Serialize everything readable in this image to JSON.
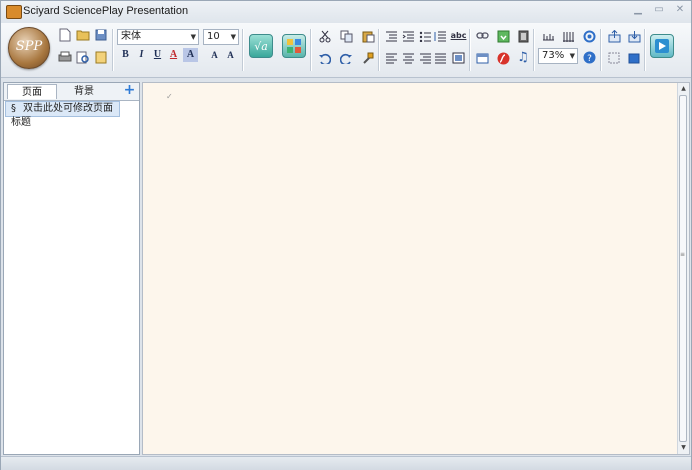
{
  "window": {
    "title": "Sciyard SciencePlay Presentation"
  },
  "app_orb": {
    "label": "SPP"
  },
  "ribbon": {
    "font_name": "宋体",
    "font_size": "10",
    "zoom": "73%",
    "format_labels": {
      "bold": "B",
      "italic": "I",
      "underline": "U",
      "font_color": "A",
      "highlight": "A",
      "grow_font": "A",
      "shrink_font": "A"
    },
    "spell_label": "abc",
    "formula_label": "√a"
  },
  "left_panel": {
    "tabs": [
      {
        "label": "页面"
      },
      {
        "label": "背景"
      }
    ],
    "add_label": "+",
    "slides": [
      {
        "number": "§",
        "title": "双击此处可修改页面标题"
      }
    ]
  },
  "canvas": {
    "mark": "✓"
  },
  "colors": {
    "canvas_bg": "#fdf6ec",
    "accent": "#2f7bd6",
    "selection": "#dbe8f7"
  }
}
